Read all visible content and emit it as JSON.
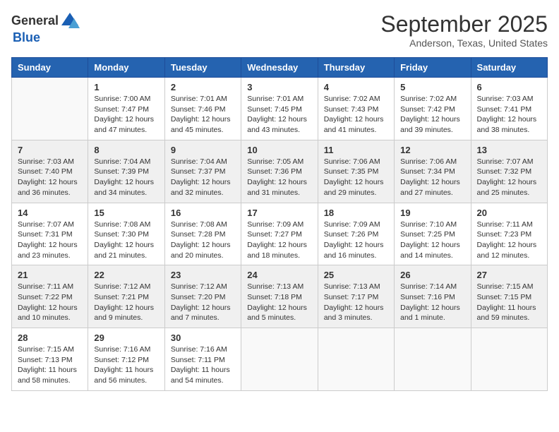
{
  "header": {
    "logo_general": "General",
    "logo_blue": "Blue",
    "month": "September 2025",
    "location": "Anderson, Texas, United States"
  },
  "weekdays": [
    "Sunday",
    "Monday",
    "Tuesday",
    "Wednesday",
    "Thursday",
    "Friday",
    "Saturday"
  ],
  "weeks": [
    [
      {
        "day": "",
        "info": ""
      },
      {
        "day": "1",
        "info": "Sunrise: 7:00 AM\nSunset: 7:47 PM\nDaylight: 12 hours\nand 47 minutes."
      },
      {
        "day": "2",
        "info": "Sunrise: 7:01 AM\nSunset: 7:46 PM\nDaylight: 12 hours\nand 45 minutes."
      },
      {
        "day": "3",
        "info": "Sunrise: 7:01 AM\nSunset: 7:45 PM\nDaylight: 12 hours\nand 43 minutes."
      },
      {
        "day": "4",
        "info": "Sunrise: 7:02 AM\nSunset: 7:43 PM\nDaylight: 12 hours\nand 41 minutes."
      },
      {
        "day": "5",
        "info": "Sunrise: 7:02 AM\nSunset: 7:42 PM\nDaylight: 12 hours\nand 39 minutes."
      },
      {
        "day": "6",
        "info": "Sunrise: 7:03 AM\nSunset: 7:41 PM\nDaylight: 12 hours\nand 38 minutes."
      }
    ],
    [
      {
        "day": "7",
        "info": "Sunrise: 7:03 AM\nSunset: 7:40 PM\nDaylight: 12 hours\nand 36 minutes."
      },
      {
        "day": "8",
        "info": "Sunrise: 7:04 AM\nSunset: 7:39 PM\nDaylight: 12 hours\nand 34 minutes."
      },
      {
        "day": "9",
        "info": "Sunrise: 7:04 AM\nSunset: 7:37 PM\nDaylight: 12 hours\nand 32 minutes."
      },
      {
        "day": "10",
        "info": "Sunrise: 7:05 AM\nSunset: 7:36 PM\nDaylight: 12 hours\nand 31 minutes."
      },
      {
        "day": "11",
        "info": "Sunrise: 7:06 AM\nSunset: 7:35 PM\nDaylight: 12 hours\nand 29 minutes."
      },
      {
        "day": "12",
        "info": "Sunrise: 7:06 AM\nSunset: 7:34 PM\nDaylight: 12 hours\nand 27 minutes."
      },
      {
        "day": "13",
        "info": "Sunrise: 7:07 AM\nSunset: 7:32 PM\nDaylight: 12 hours\nand 25 minutes."
      }
    ],
    [
      {
        "day": "14",
        "info": "Sunrise: 7:07 AM\nSunset: 7:31 PM\nDaylight: 12 hours\nand 23 minutes."
      },
      {
        "day": "15",
        "info": "Sunrise: 7:08 AM\nSunset: 7:30 PM\nDaylight: 12 hours\nand 21 minutes."
      },
      {
        "day": "16",
        "info": "Sunrise: 7:08 AM\nSunset: 7:28 PM\nDaylight: 12 hours\nand 20 minutes."
      },
      {
        "day": "17",
        "info": "Sunrise: 7:09 AM\nSunset: 7:27 PM\nDaylight: 12 hours\nand 18 minutes."
      },
      {
        "day": "18",
        "info": "Sunrise: 7:09 AM\nSunset: 7:26 PM\nDaylight: 12 hours\nand 16 minutes."
      },
      {
        "day": "19",
        "info": "Sunrise: 7:10 AM\nSunset: 7:25 PM\nDaylight: 12 hours\nand 14 minutes."
      },
      {
        "day": "20",
        "info": "Sunrise: 7:11 AM\nSunset: 7:23 PM\nDaylight: 12 hours\nand 12 minutes."
      }
    ],
    [
      {
        "day": "21",
        "info": "Sunrise: 7:11 AM\nSunset: 7:22 PM\nDaylight: 12 hours\nand 10 minutes."
      },
      {
        "day": "22",
        "info": "Sunrise: 7:12 AM\nSunset: 7:21 PM\nDaylight: 12 hours\nand 9 minutes."
      },
      {
        "day": "23",
        "info": "Sunrise: 7:12 AM\nSunset: 7:20 PM\nDaylight: 12 hours\nand 7 minutes."
      },
      {
        "day": "24",
        "info": "Sunrise: 7:13 AM\nSunset: 7:18 PM\nDaylight: 12 hours\nand 5 minutes."
      },
      {
        "day": "25",
        "info": "Sunrise: 7:13 AM\nSunset: 7:17 PM\nDaylight: 12 hours\nand 3 minutes."
      },
      {
        "day": "26",
        "info": "Sunrise: 7:14 AM\nSunset: 7:16 PM\nDaylight: 12 hours\nand 1 minute."
      },
      {
        "day": "27",
        "info": "Sunrise: 7:15 AM\nSunset: 7:15 PM\nDaylight: 11 hours\nand 59 minutes."
      }
    ],
    [
      {
        "day": "28",
        "info": "Sunrise: 7:15 AM\nSunset: 7:13 PM\nDaylight: 11 hours\nand 58 minutes."
      },
      {
        "day": "29",
        "info": "Sunrise: 7:16 AM\nSunset: 7:12 PM\nDaylight: 11 hours\nand 56 minutes."
      },
      {
        "day": "30",
        "info": "Sunrise: 7:16 AM\nSunset: 7:11 PM\nDaylight: 11 hours\nand 54 minutes."
      },
      {
        "day": "",
        "info": ""
      },
      {
        "day": "",
        "info": ""
      },
      {
        "day": "",
        "info": ""
      },
      {
        "day": "",
        "info": ""
      }
    ]
  ]
}
